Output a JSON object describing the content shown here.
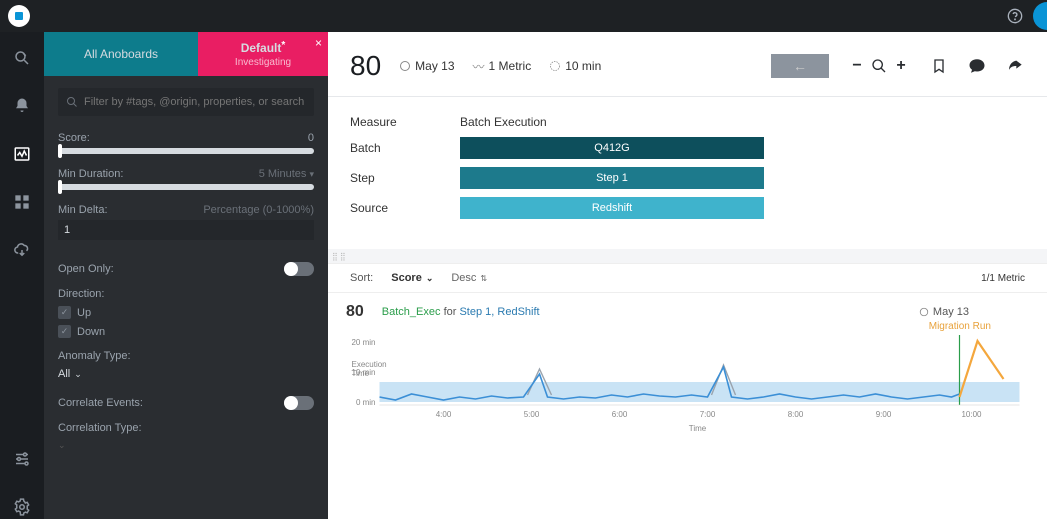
{
  "topbar": {
    "help_icon": "help-circle"
  },
  "iconrail": {
    "items": [
      "search",
      "bell",
      "anomaly",
      "grid",
      "cloud-download"
    ],
    "bottom": [
      "sliders",
      "gear"
    ]
  },
  "tabs": {
    "all": "All Anoboards",
    "active_title": "Default",
    "active_sub": "Investigating"
  },
  "filters": {
    "search_placeholder": "Filter by #tags, @origin, properties, or search",
    "score_label": "Score:",
    "score_value": "0",
    "min_duration_label": "Min Duration:",
    "min_duration_value": "5 Minutes",
    "min_delta_label": "Min Delta:",
    "min_delta_hint": "Percentage (0-1000%)",
    "min_delta_value": "1",
    "open_only_label": "Open Only:",
    "direction_label": "Direction:",
    "direction_up": "Up",
    "direction_down": "Down",
    "anomaly_type_label": "Anomaly Type:",
    "anomaly_type_value": "All",
    "correlate_label": "Correlate Events:",
    "correlation_type_label": "Correlation Type:"
  },
  "header": {
    "score": "80",
    "date": "May 13",
    "metric": "1 Metric",
    "duration": "10 min",
    "back_icon": "←"
  },
  "details": {
    "measure_label": "Measure",
    "measure_value": "Batch Execution",
    "batch_label": "Batch",
    "batch_value": "Q412G",
    "step_label": "Step",
    "step_value": "Step 1",
    "source_label": "Source",
    "source_value": "Redshift"
  },
  "sort": {
    "label": "Sort:",
    "value": "Score",
    "order": "Desc",
    "metric_count": "1/1 Metric"
  },
  "chart": {
    "score": "80",
    "link1": "Batch_Exec",
    "for": "for",
    "link2": "Step 1",
    "comma": ",",
    "link3": "RedShift",
    "date": "May 13",
    "annotation": "Migration Run",
    "ylabel_line1": "Execution",
    "ylabel_line2": "Time",
    "xtitle": "Time"
  },
  "chart_data": {
    "type": "line",
    "xlabel": "Time",
    "ylabel": "Execution Time",
    "ylim": [
      0,
      20
    ],
    "yunit": "min",
    "yticks": [
      0,
      10,
      20
    ],
    "xticks": [
      "4:00",
      "5:00",
      "6:00",
      "7:00",
      "8:00",
      "9:00",
      "10:00"
    ],
    "series": [
      {
        "name": "Batch_Exec",
        "color": "#3b8fd6",
        "x": [
          "3:30",
          "3:45",
          "4:00",
          "4:15",
          "4:30",
          "4:45",
          "5:00",
          "5:05",
          "5:15",
          "5:30",
          "5:45",
          "6:00",
          "6:15",
          "6:30",
          "6:45",
          "7:00",
          "7:10",
          "7:20",
          "7:30",
          "7:45",
          "8:00",
          "8:15",
          "8:30",
          "8:45",
          "9:00",
          "9:15",
          "9:30",
          "9:45",
          "10:00",
          "10:10"
        ],
        "y": [
          3,
          2,
          4,
          3,
          2,
          3,
          9,
          3,
          2,
          3,
          2,
          3,
          4,
          3,
          4,
          3,
          11,
          3,
          2,
          3,
          4,
          3,
          2,
          3,
          4,
          3,
          2,
          4,
          3,
          4
        ]
      },
      {
        "name": "Migration Run",
        "color": "#f4a73d",
        "x": [
          "10:10",
          "10:20",
          "10:35"
        ],
        "y": [
          3,
          19,
          8
        ]
      }
    ],
    "band": {
      "color": "#c9e3f5",
      "ymin": 1,
      "ymax": 6
    },
    "annotation_x": "10:10",
    "annotation_text": "Migration Run"
  }
}
